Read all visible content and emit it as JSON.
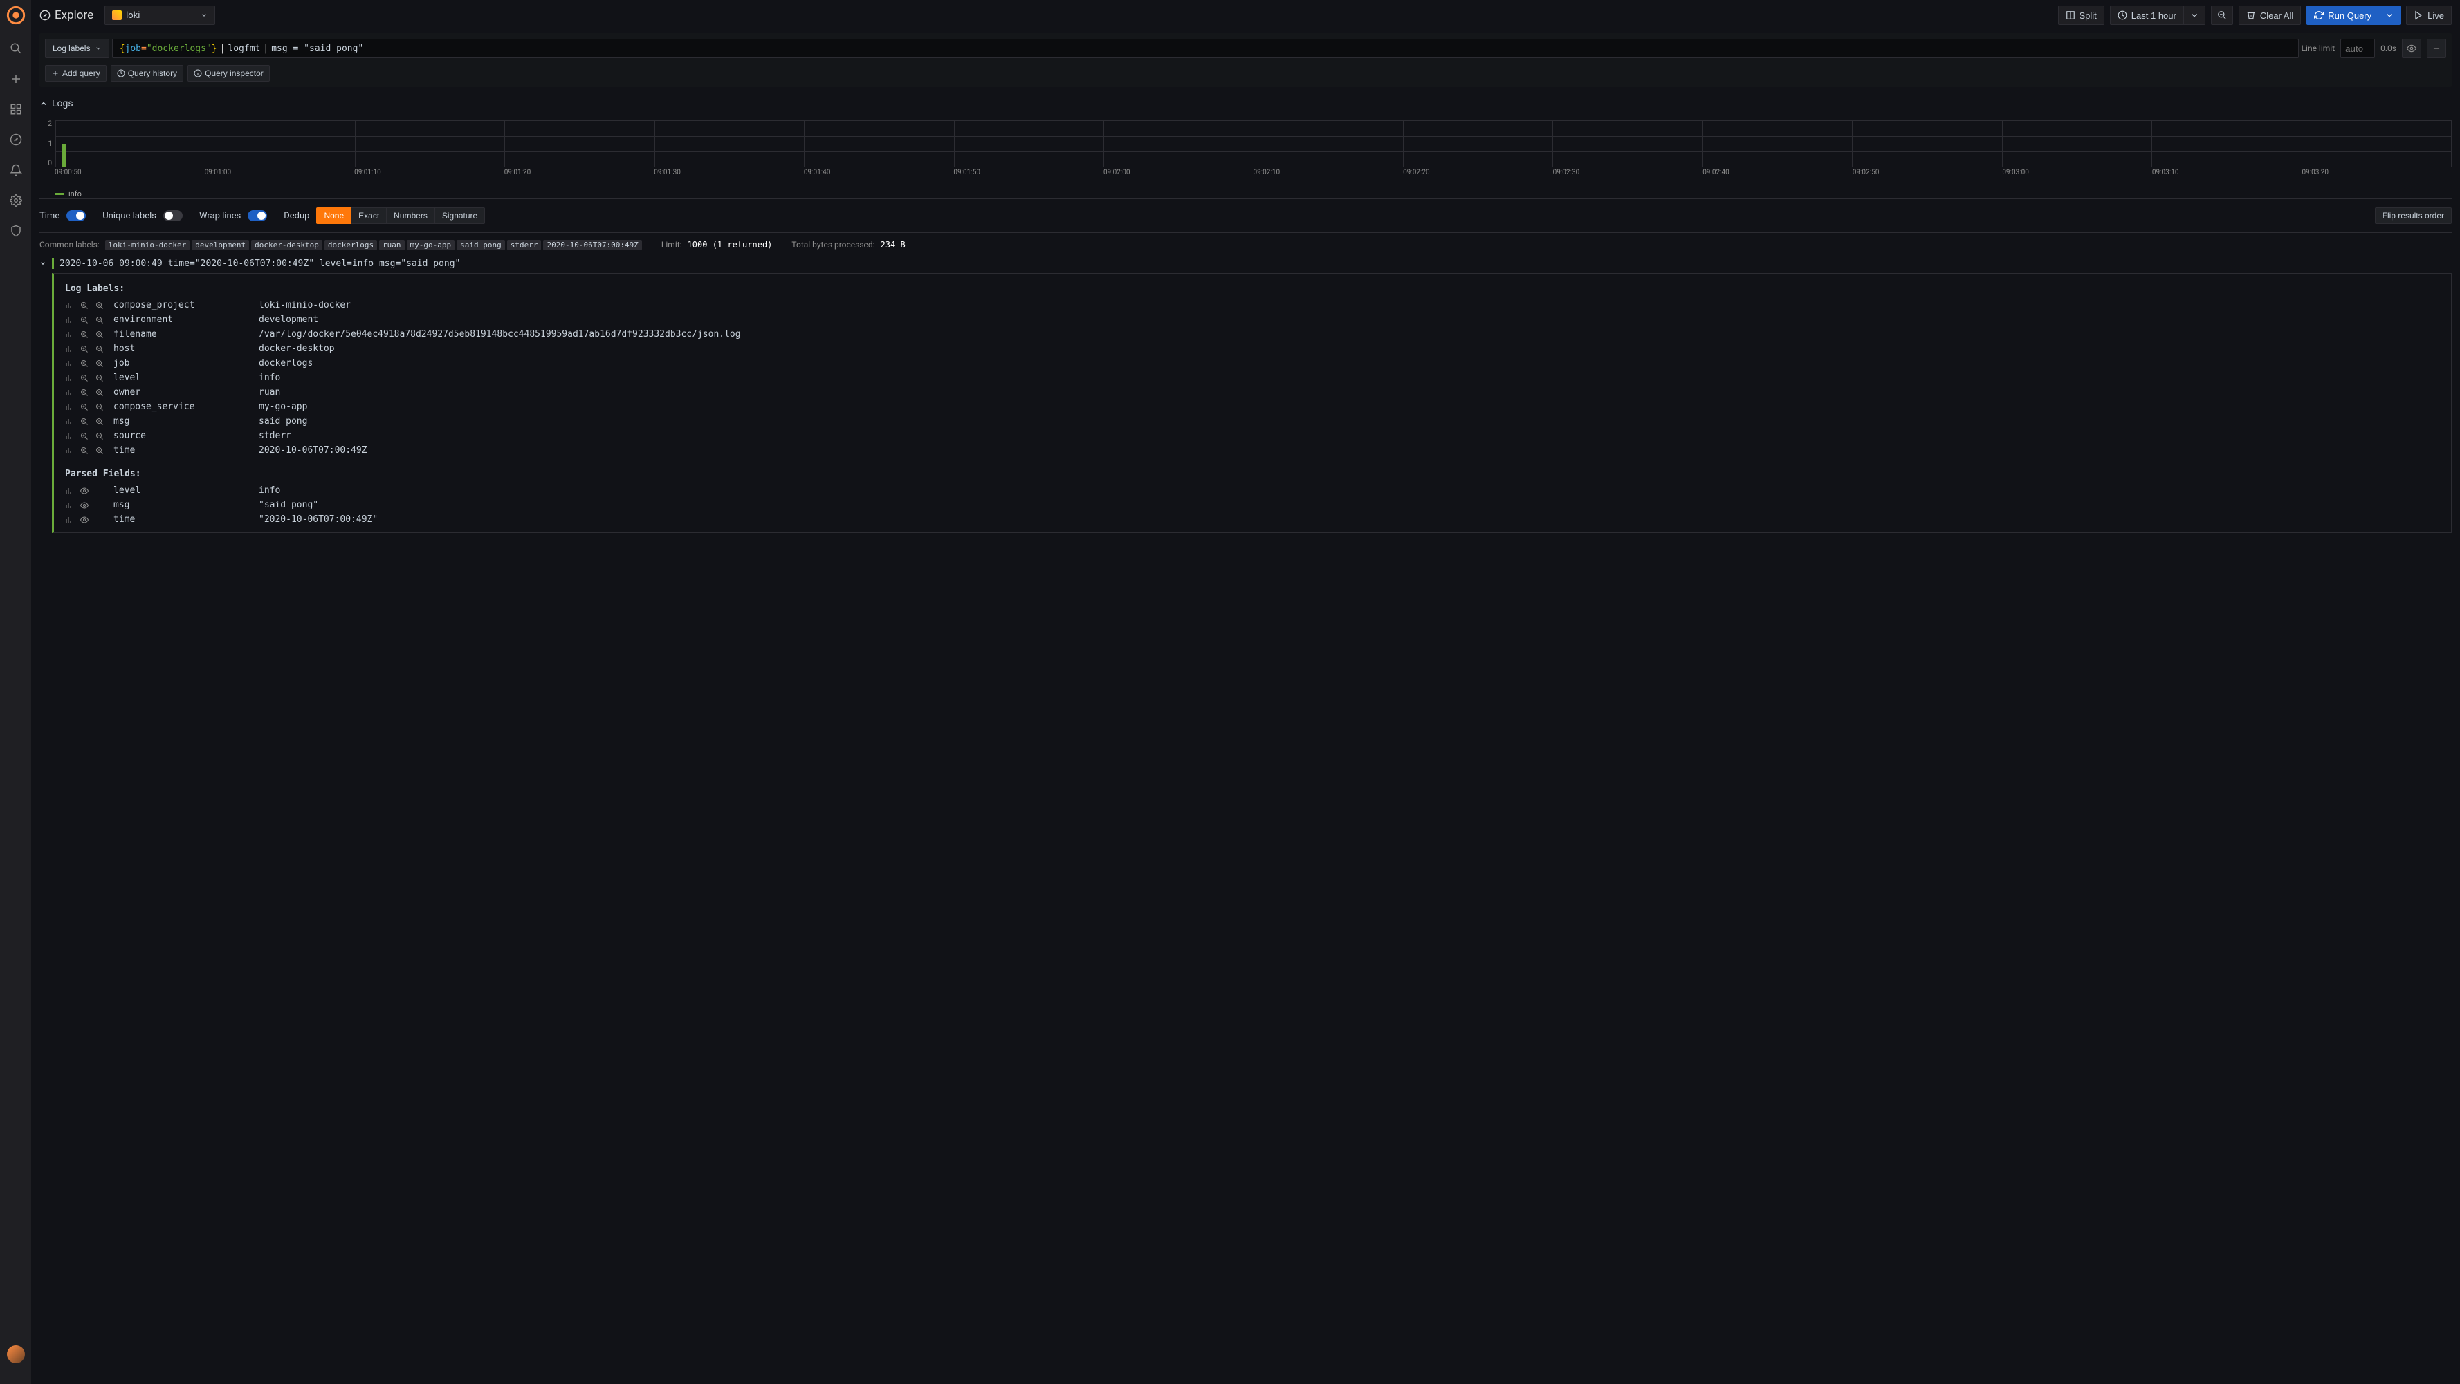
{
  "header": {
    "title": "Explore",
    "datasource": "loki",
    "split": "Split",
    "time_range": "Last 1 hour",
    "clear_all": "Clear All",
    "run_query": "Run Query",
    "live": "Live"
  },
  "query": {
    "log_labels_btn": "Log labels",
    "expr_parts": {
      "lbrace": "{",
      "key": "job",
      "eq": "=",
      "val": "\"dockerlogs\"",
      "rbrace": "}",
      "pipe1": " | ",
      "parser": "logfmt",
      "pipe2": " | ",
      "filter": "msg = \"said pong\""
    },
    "line_limit_label": "Line limit",
    "line_limit_placeholder": "auto",
    "interval": "0.0s",
    "add_query": "Add query",
    "query_history": "Query history",
    "query_inspector": "Query inspector"
  },
  "logs": {
    "title": "Logs",
    "options": {
      "time": "Time",
      "unique_labels": "Unique labels",
      "wrap_lines": "Wrap lines",
      "dedup": "Dedup",
      "dedup_options": [
        "None",
        "Exact",
        "Numbers",
        "Signature"
      ],
      "dedup_active": "None",
      "flip": "Flip results order"
    },
    "common_labels_label": "Common labels:",
    "common_labels": [
      "loki-minio-docker",
      "development",
      "docker-desktop",
      "dockerlogs",
      "ruan",
      "my-go-app",
      "said pong",
      "stderr",
      "2020-10-06T07:00:49Z"
    ],
    "limit_label": "Limit:",
    "limit_value": "1000 (1 returned)",
    "bytes_label": "Total bytes processed:",
    "bytes_value": "234 B",
    "log_entry": {
      "ts": "2020-10-06 09:00:49",
      "msg": "time=\"2020-10-06T07:00:49Z\" level=info msg=\"said pong\""
    },
    "details": {
      "labels_title": "Log Labels:",
      "label_rows": [
        {
          "k": "compose_project",
          "v": "loki-minio-docker"
        },
        {
          "k": "environment",
          "v": "development"
        },
        {
          "k": "filename",
          "v": "/var/log/docker/5e04ec4918a78d24927d5eb819148bcc448519959ad17ab16d7df923332db3cc/json.log"
        },
        {
          "k": "host",
          "v": "docker-desktop"
        },
        {
          "k": "job",
          "v": "dockerlogs"
        },
        {
          "k": "level",
          "v": "info"
        },
        {
          "k": "owner",
          "v": "ruan"
        },
        {
          "k": "compose_service",
          "v": "my-go-app"
        },
        {
          "k": "msg",
          "v": "said pong"
        },
        {
          "k": "source",
          "v": "stderr"
        },
        {
          "k": "time",
          "v": "2020-10-06T07:00:49Z"
        }
      ],
      "parsed_title": "Parsed Fields:",
      "parsed_rows": [
        {
          "k": "level",
          "v": "info"
        },
        {
          "k": "msg",
          "v": "\"said pong\""
        },
        {
          "k": "time",
          "v": "\"2020-10-06T07:00:49Z\""
        }
      ]
    }
  },
  "chart_data": {
    "type": "bar",
    "categories": [
      "09:00:50",
      "09:01:00",
      "09:01:10",
      "09:01:20",
      "09:01:30",
      "09:01:40",
      "09:01:50",
      "09:02:00",
      "09:02:10",
      "09:02:20",
      "09:02:30",
      "09:02:40",
      "09:02:50",
      "09:03:00",
      "09:03:10",
      "09:03:20"
    ],
    "series": [
      {
        "name": "info",
        "values": [
          1,
          0,
          0,
          0,
          0,
          0,
          0,
          0,
          0,
          0,
          0,
          0,
          0,
          0,
          0,
          0
        ]
      }
    ],
    "ylim": [
      0,
      2
    ],
    "yticks": [
      0,
      1,
      2
    ],
    "legend": "info"
  }
}
